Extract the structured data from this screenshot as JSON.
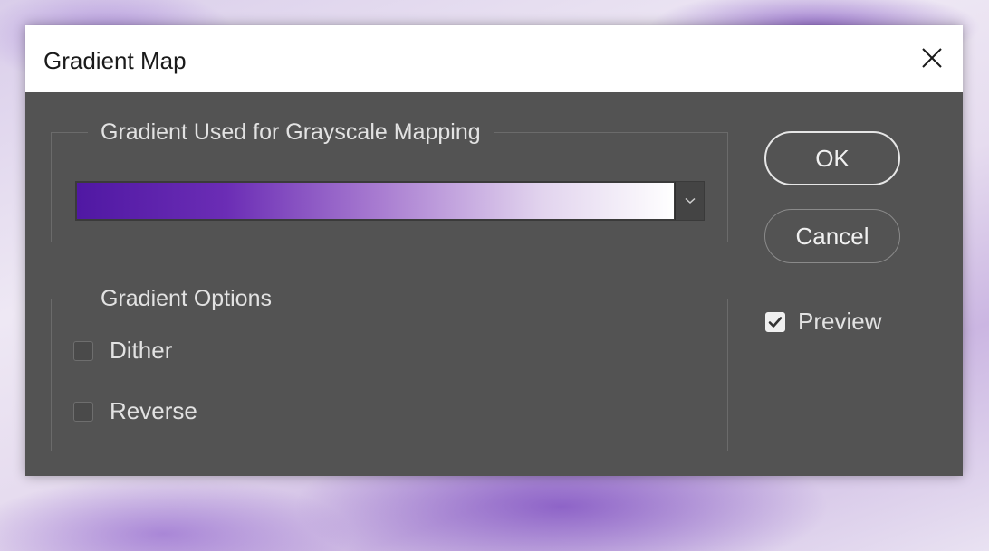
{
  "window": {
    "title": "Gradient Map",
    "close_icon": "close-icon"
  },
  "gradient_group": {
    "legend": "Gradient Used for Grayscale Mapping",
    "gradient_colors": [
      "#5018a3",
      "#6b2db5",
      "#a77ad0",
      "#e2d4ee",
      "#ffffff"
    ],
    "dropdown_icon": "chevron-down-icon"
  },
  "options_group": {
    "legend": "Gradient Options",
    "dither": {
      "label": "Dither",
      "checked": false
    },
    "reverse": {
      "label": "Reverse",
      "checked": false
    }
  },
  "buttons": {
    "ok": "OK",
    "cancel": "Cancel"
  },
  "preview": {
    "label": "Preview",
    "checked": true
  },
  "colors": {
    "dialog_bg": "#535353",
    "text": "#e2e2e2",
    "titlebar_bg": "#ffffff"
  }
}
